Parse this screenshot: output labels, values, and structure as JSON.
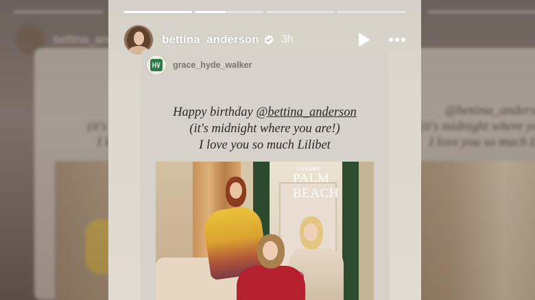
{
  "story": {
    "username": "bettina_anderson",
    "time_ago": "3h",
    "progress": [
      1,
      1,
      0,
      0
    ],
    "progress_current_fraction": 0.45
  },
  "shared_post": {
    "source_username": "grace_hyde_walker",
    "message_line1_prefix": "Happy birthday ",
    "message_mention": "@bettina_anderson",
    "message_line2": "(it's midnight where you are!)",
    "message_line3": "I love you so much Lilibet",
    "magazine_small": "LUXURY",
    "magazine_title": "PALM BEACH"
  },
  "icons": {
    "verified": "verified-badge-icon",
    "play": "play-icon",
    "more": "more-horizontal-icon"
  },
  "colors": {
    "story_bg": "#ddd8ce",
    "text_dark": "#2a2622",
    "verified_white": "#ffffff"
  }
}
